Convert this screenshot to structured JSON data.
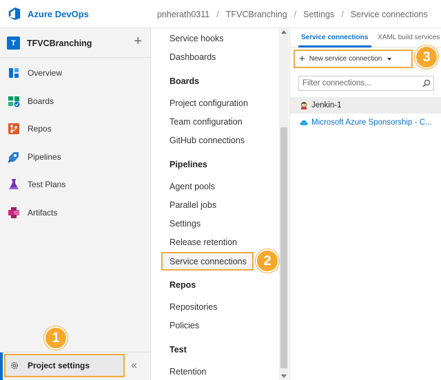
{
  "topbar": {
    "brand": "Azure DevOps",
    "breadcrumbs": [
      "pnherath0311",
      "TFVCBranching",
      "Settings",
      "Service connections"
    ],
    "separator": "/"
  },
  "project": {
    "avatar_letter": "T",
    "name": "TFVCBranching",
    "add_symbol": "+"
  },
  "leftnav": {
    "items": [
      {
        "label": "Overview",
        "icon": "overview-icon",
        "color": "#0a6fcf"
      },
      {
        "label": "Boards",
        "icon": "boards-icon",
        "color": "#009a63"
      },
      {
        "label": "Repos",
        "icon": "repos-icon",
        "color": "#e05b29"
      },
      {
        "label": "Pipelines",
        "icon": "pipelines-icon",
        "color": "#2f7ed8"
      },
      {
        "label": "Test Plans",
        "icon": "test-plans-icon",
        "color": "#7a2fb5"
      },
      {
        "label": "Artifacts",
        "icon": "artifacts-icon",
        "color": "#c7297b"
      }
    ],
    "settings_label": "Project settings",
    "collapse_symbol": "«"
  },
  "settings_nav": {
    "service_hooks": "Service hooks",
    "dashboards": "Dashboards",
    "boards_heading": "Boards",
    "project_configuration": "Project configuration",
    "team_configuration": "Team configuration",
    "github_connections": "GitHub connections",
    "pipelines_heading": "Pipelines",
    "agent_pools": "Agent pools",
    "parallel_jobs": "Parallel jobs",
    "settings": "Settings",
    "release_retention": "Release retention",
    "service_connections": "Service connections",
    "repos_heading": "Repos",
    "repositories": "Repositories",
    "policies": "Policies",
    "test_heading": "Test",
    "retention": "Retention"
  },
  "right_panel": {
    "tab_active": "Service connections",
    "tab_other": "XAML build services",
    "new_connection_label": "New service connection",
    "filter_placeholder": "Filter connections...",
    "connections": [
      {
        "name": "Jenkin-1",
        "icon": "jenkins-icon"
      },
      {
        "name": "Microsoft Azure Sponsorship - C...",
        "icon": "azure-cloud-icon"
      }
    ]
  },
  "callouts": [
    "1",
    "2",
    "3"
  ],
  "colors": {
    "accent": "#0a6fcf",
    "callout": "#f7a82a",
    "highlight_border": "#f2a93b"
  }
}
